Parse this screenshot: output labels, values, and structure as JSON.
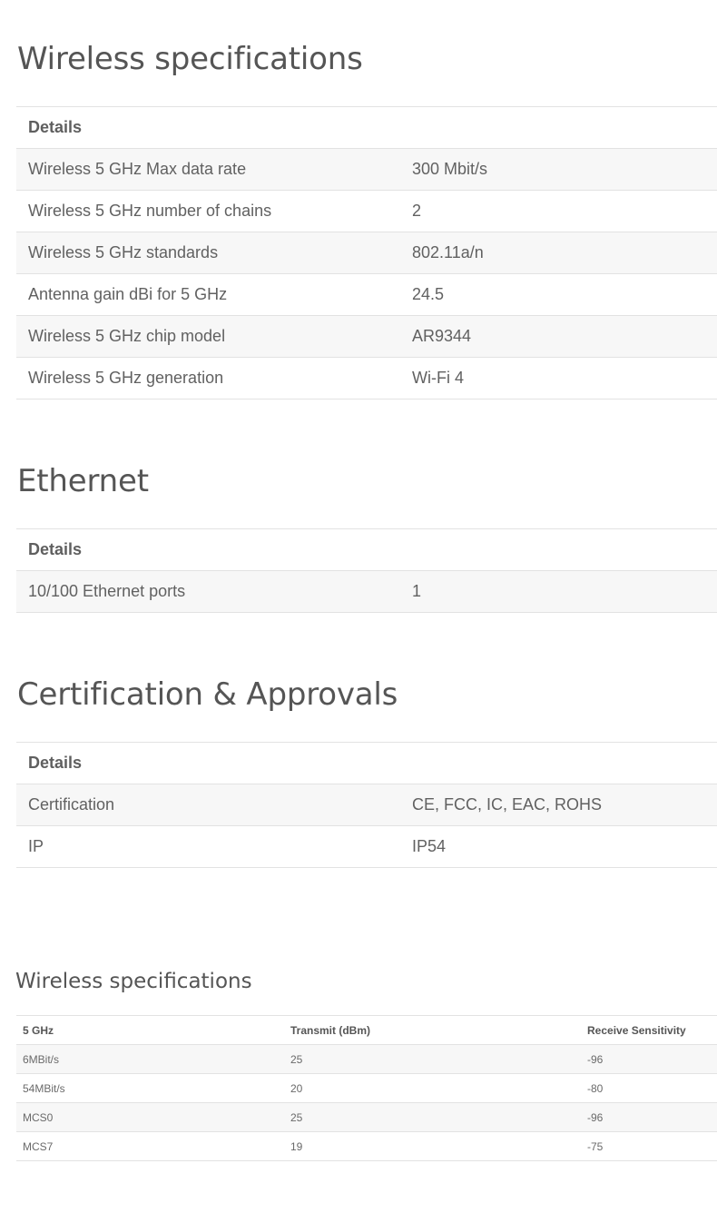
{
  "sections": [
    {
      "title": "Wireless specifications",
      "header": "Details",
      "rows": [
        {
          "label": "Wireless 5 GHz Max data rate",
          "value": "300 Mbit/s"
        },
        {
          "label": "Wireless 5 GHz number of chains",
          "value": "2"
        },
        {
          "label": "Wireless 5 GHz standards",
          "value": "802.11a/n"
        },
        {
          "label": "Antenna gain dBi for 5 GHz",
          "value": "24.5"
        },
        {
          "label": "Wireless 5 GHz chip model",
          "value": "AR9344"
        },
        {
          "label": "Wireless 5 GHz generation",
          "value": "Wi-Fi 4"
        }
      ]
    },
    {
      "title": "Ethernet",
      "header": "Details",
      "rows": [
        {
          "label": "10/100 Ethernet ports",
          "value": "1"
        }
      ]
    },
    {
      "title": "Certification & Approvals",
      "header": "Details",
      "rows": [
        {
          "label": "Certification",
          "value": "CE, FCC, IC, EAC, ROHS"
        },
        {
          "label": "IP",
          "value": "IP54"
        }
      ]
    }
  ],
  "performance": {
    "title": "Wireless specifications",
    "columns": [
      "5 GHz",
      "Transmit (dBm)",
      "Receive Sensitivity"
    ],
    "rows": [
      [
        "6MBit/s",
        "25",
        "-96"
      ],
      [
        "54MBit/s",
        "20",
        "-80"
      ],
      [
        "MCS0",
        "25",
        "-96"
      ],
      [
        "MCS7",
        "19",
        "-75"
      ]
    ]
  }
}
